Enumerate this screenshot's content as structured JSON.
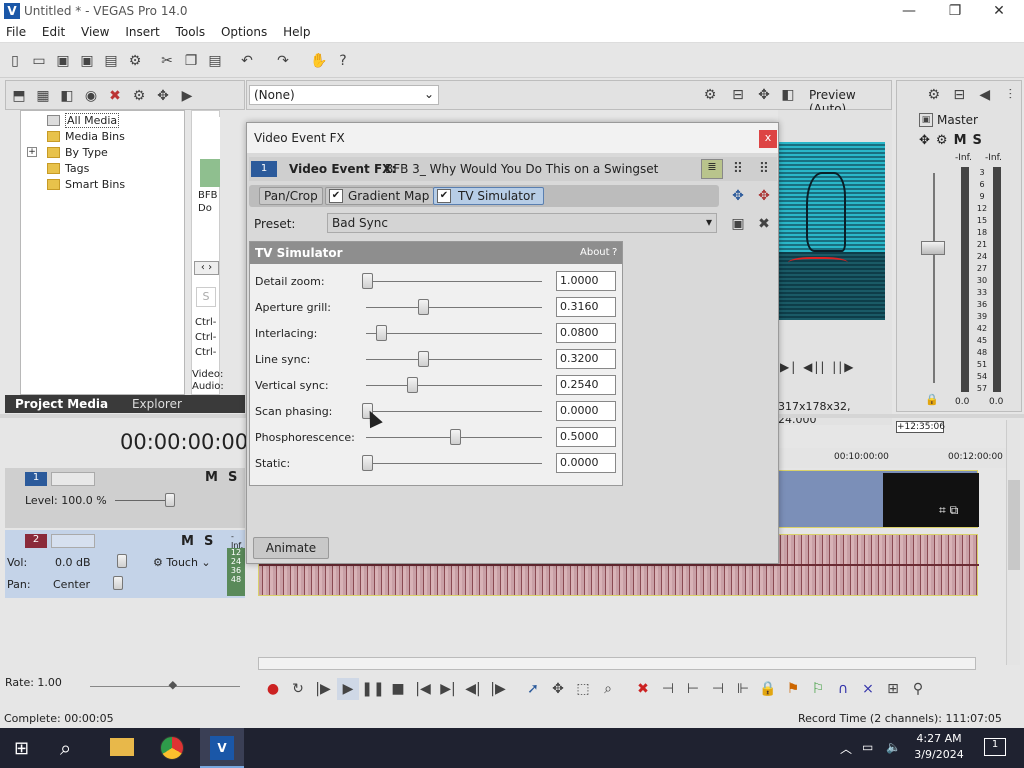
{
  "window": {
    "title": "Untitled * - VEGAS Pro 14.0",
    "minimize": "—",
    "maximize": "❐",
    "close": "✕"
  },
  "menu": [
    "File",
    "Edit",
    "View",
    "Insert",
    "Tools",
    "Options",
    "Help"
  ],
  "preview": {
    "fx_select": "(None)",
    "quality": "Preview (Auto)",
    "info": "317x178x32, 24.000",
    "timecode_badge": "+12:35:06"
  },
  "master": {
    "label": "Master",
    "m": "M",
    "s": "S",
    "inf_left": "-Inf.",
    "inf_right": "-Inf.",
    "val_left": "0.0",
    "val_right": "0.0",
    "scale": [
      "3",
      "6",
      "9",
      "12",
      "15",
      "18",
      "21",
      "24",
      "27",
      "30",
      "33",
      "36",
      "39",
      "42",
      "45",
      "48",
      "51",
      "54",
      "57"
    ]
  },
  "explorer": {
    "tree": [
      "All Media",
      "Media Bins",
      "By Type",
      "Tags",
      "Smart Bins"
    ],
    "thumb_label": "BFB Do T",
    "ctrl": [
      "Ctrl-",
      "Ctrl-",
      "Ctrl-"
    ],
    "video_label": "Video:",
    "audio_label": "Audio:",
    "tabs": [
      "Project Media",
      "Explorer"
    ]
  },
  "timeline": {
    "timecode": "00:00:00:00",
    "ruler": [
      "00:10:00:00",
      "00:12:00:00"
    ],
    "track1": {
      "num": "1",
      "level": "Level: 100.0 %",
      "m": "M",
      "s": "S"
    },
    "track2": {
      "num": "2",
      "vol_label": "Vol:",
      "vol": "0.0 dB",
      "pan_label": "Pan:",
      "pan": "Center",
      "touch": "Touch",
      "m": "M",
      "s": "S",
      "meter": [
        "-Inf.",
        "12",
        "24",
        "36",
        "48"
      ]
    },
    "rate": "Rate: 1.00"
  },
  "status": {
    "left": "Complete: 00:00:05",
    "right": "Record Time (2 channels): 111:07:05"
  },
  "dialog": {
    "title": "Video Event FX",
    "close": "x",
    "chain_num": "1",
    "chain_label": "Video Event FX:",
    "chain_name": "BFB 3_ Why Would You Do This on a Swingset",
    "plugins": [
      "Pan/Crop",
      "Gradient Map",
      "TV Simulator"
    ],
    "preset_label": "Preset:",
    "preset_value": "Bad Sync",
    "panel_title": "TV Simulator",
    "about": "About",
    "help": "?",
    "animate": "Animate",
    "params": [
      {
        "label": "Detail zoom:",
        "value": "1.0000",
        "pos": 0.0
      },
      {
        "label": "Aperture grill:",
        "value": "0.3160",
        "pos": 0.32
      },
      {
        "label": "Interlacing:",
        "value": "0.0800",
        "pos": 0.08
      },
      {
        "label": "Line sync:",
        "value": "0.3200",
        "pos": 0.32
      },
      {
        "label": "Vertical sync:",
        "value": "0.2540",
        "pos": 0.254
      },
      {
        "label": "Scan phasing:",
        "value": "0.0000",
        "pos": 0.0
      },
      {
        "label": "Phosphorescence:",
        "value": "0.5000",
        "pos": 0.5
      },
      {
        "label": "Static:",
        "value": "0.0000",
        "pos": 0.0
      }
    ]
  },
  "taskbar": {
    "time": "4:27 AM",
    "date": "3/9/2024",
    "notif": "1"
  }
}
